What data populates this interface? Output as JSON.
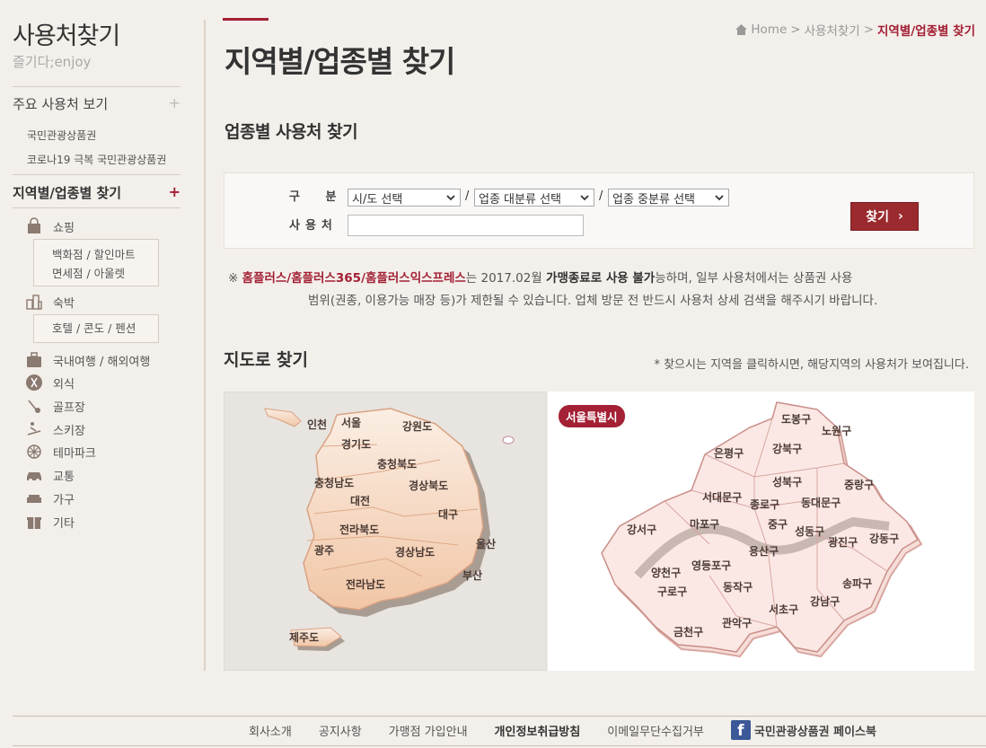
{
  "sidebar": {
    "title": "사용처찾기",
    "subtitle": "즐기다;enjoy",
    "section_main": "주요 사용처 보기",
    "links": [
      "국민관광상품권",
      "코로나19 극복 국민관광상품권"
    ],
    "section_active": "지역별/업종별 찾기",
    "plus": "+",
    "categories": {
      "shopping": "쇼핑",
      "shopping_sub": [
        "백화점 / 할인마트",
        "면세점 / 아울렛"
      ],
      "lodging": "숙박",
      "lodging_sub": [
        "호텔 / 콘도 / 펜션"
      ],
      "travel": "국내여행 / 해외여행",
      "dining": "외식",
      "golf": "골프장",
      "ski": "스키장",
      "themepark": "테마파크",
      "transport": "교통",
      "furniture": "가구",
      "etc": "기타"
    }
  },
  "breadcrumb": {
    "home": "Home",
    "parent": "사용처찾기",
    "current": "지역별/업종별 찾기",
    "sep": ">"
  },
  "page_title": "지역별/업종별 찾기",
  "search": {
    "heading": "업종별 사용처 찾기",
    "label_type": "구 분",
    "label_user": "사용처",
    "select_city": "시/도 선택",
    "select_major": "업종 대분류 선택",
    "select_minor": "업종 중분류 선택",
    "slash": "/",
    "find_button": "찾기",
    "find_arrow": "›"
  },
  "notice": {
    "mark": "※",
    "brand": "홈플러스/홈플러스365/홈플러스익스프레스",
    "t1": "는 2017.02월 ",
    "strong": "가맹종료로 사용 불가",
    "t2": "능하며, 일부 사용처에서는 상품권 사용",
    "line2": "범위(권종, 이용가능 매장 등)가 제한될 수 있습니다. 업체 방문 전 반드시 사용처 상세 검색을 해주시기 바랍니다."
  },
  "map": {
    "heading": "지도로 찾기",
    "hint": "* 찾으시는 지역을 클릭하시면, 해당지역의 사용처가 보여집니다.",
    "provinces": [
      "인천",
      "서울",
      "강원도",
      "경기도",
      "충청북도",
      "충청남도",
      "경상북도",
      "대전",
      "대구",
      "전라북도",
      "울산",
      "광주",
      "경상남도",
      "부산",
      "전라남도",
      "제주도"
    ],
    "seoul_badge": "서울특별시",
    "districts": [
      "도봉구",
      "노원구",
      "은평구",
      "강북구",
      "성북구",
      "중랑구",
      "서대문구",
      "종로구",
      "동대문구",
      "마포구",
      "중구",
      "성동구",
      "광진구",
      "강동구",
      "강서구",
      "용산구",
      "양천구",
      "영등포구",
      "구로구",
      "동작구",
      "송파구",
      "강남구",
      "서초구",
      "관악구",
      "금천구"
    ]
  },
  "footer": {
    "items": [
      "회사소개",
      "공지사항",
      "가맹점 가입안내",
      "개인정보취급방침",
      "이메일무단수집거부"
    ],
    "facebook": "국민관광상품권 페이스북",
    "fb_letter": "f"
  },
  "colors": {
    "accent": "#a32035",
    "button": "#9a2a2e",
    "background": "#f3efea"
  }
}
